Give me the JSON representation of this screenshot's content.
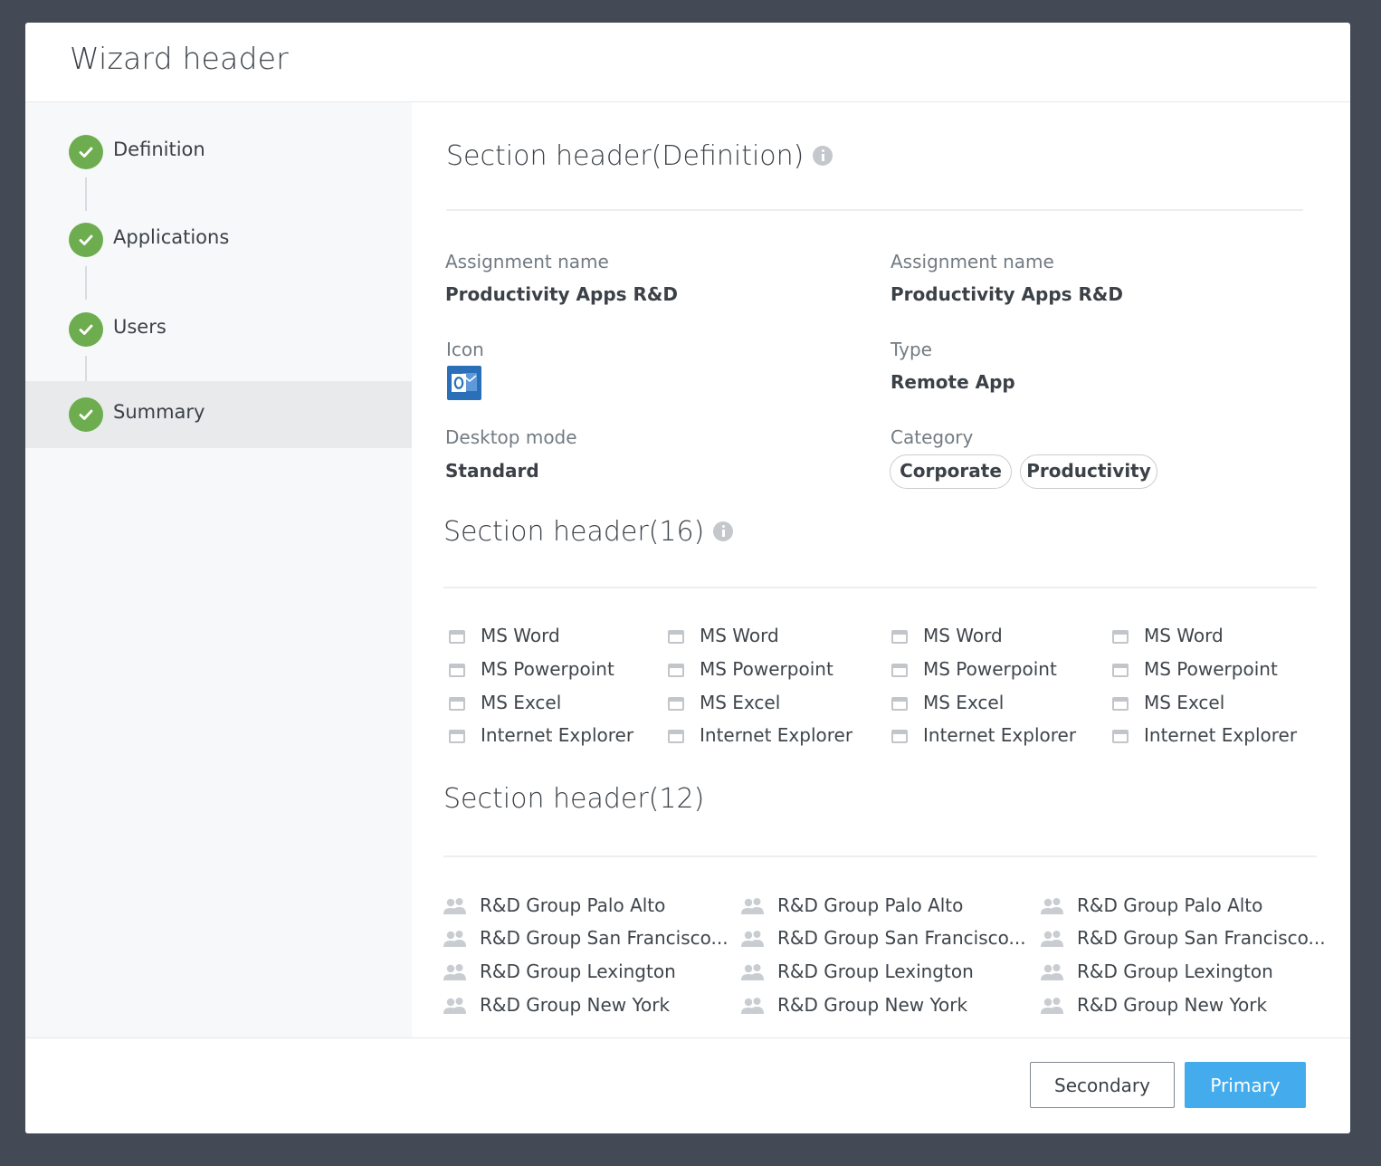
{
  "wizard": {
    "title": "Wizard header"
  },
  "steps": [
    {
      "label": "Definition"
    },
    {
      "label": "Applications"
    },
    {
      "label": "Users"
    },
    {
      "label": "Summary"
    }
  ],
  "definition": {
    "header": "Section header(Definition)",
    "assignment_label_1": "Assignment name",
    "assignment_value_1": "Productivity Apps R&D",
    "assignment_label_2": "Assignment name",
    "assignment_value_2": "Productivity Apps R&D",
    "icon_label": "Icon",
    "type_label": "Type",
    "type_value": "Remote App",
    "desktop_label": "Desktop mode",
    "desktop_value": "Standard",
    "category_label": "Category",
    "categories": [
      "Corporate",
      "Productivity"
    ]
  },
  "applications": {
    "header": "Section header(16)",
    "columns": [
      [
        "MS Word",
        "MS Powerpoint",
        "MS Excel",
        "Internet Explorer"
      ],
      [
        "MS Word",
        "MS Powerpoint",
        "MS Excel",
        "Internet Explorer"
      ],
      [
        "MS Word",
        "MS Powerpoint",
        "MS Excel",
        "Internet Explorer"
      ],
      [
        "MS Word",
        "MS Powerpoint",
        "MS Excel",
        "Internet Explorer"
      ]
    ]
  },
  "groups": {
    "header": "Section header(12)",
    "columns": [
      [
        "R&D Group Palo Alto",
        "R&D Group San Francisco...",
        "R&D Group Lexington",
        "R&D Group New York"
      ],
      [
        "R&D Group Palo Alto",
        "R&D Group San Francisco...",
        "R&D Group Lexington",
        "R&D Group New York"
      ],
      [
        "R&D Group Palo Alto",
        "R&D Group San Francisco...",
        "R&D Group Lexington",
        "R&D Group New York"
      ]
    ]
  },
  "footer": {
    "secondary_label": "Secondary",
    "primary_label": "Primary"
  },
  "colors": {
    "backdrop": "#434a55",
    "step_complete": "#6dad4f",
    "primary_button": "#44acec",
    "outlook_icon": "#2a6fb8"
  },
  "icons": {
    "step": "check-icon",
    "info": "info-icon",
    "app_checkbox": "checkbox-icon",
    "group": "user-group-icon",
    "app": "outlook-icon"
  }
}
